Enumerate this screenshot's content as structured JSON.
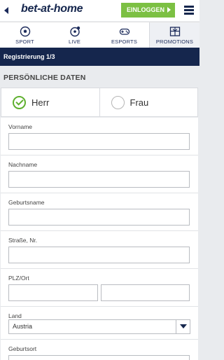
{
  "header": {
    "logo": "bet-at-home",
    "login_label": "EINLOGGEN"
  },
  "nav": {
    "tabs": [
      {
        "label": "SPORT",
        "icon": "soccer-ball-icon"
      },
      {
        "label": "LIVE",
        "icon": "live-ball-icon"
      },
      {
        "label": "ESPORTS",
        "icon": "gamepad-icon"
      },
      {
        "label": "PROMOTIONS",
        "icon": "gift-icon",
        "active": true
      }
    ]
  },
  "registration": {
    "step_label": "Registrierung  1/3"
  },
  "form": {
    "section_title": "PERSÖNLICHE DATEN",
    "gender": {
      "options": [
        "Herr",
        "Frau"
      ],
      "selected": "Herr"
    },
    "fields": {
      "vorname": {
        "label": "Vorname",
        "value": ""
      },
      "nachname": {
        "label": "Nachname",
        "value": ""
      },
      "geburtsname": {
        "label": "Geburtsname",
        "value": ""
      },
      "strasse": {
        "label": "Straße, Nr.",
        "value": ""
      },
      "plz_ort": {
        "label": "PLZ/Ort",
        "plz_value": "",
        "ort_value": ""
      },
      "land": {
        "label": "Land",
        "selected": "Austria"
      },
      "geburtsort": {
        "label": "Geburtsort",
        "value": ""
      }
    }
  },
  "colors": {
    "brand_navy": "#15264d",
    "login_green": "#7cc043",
    "check_green": "#5fb02f",
    "background": "#e9ebee"
  }
}
